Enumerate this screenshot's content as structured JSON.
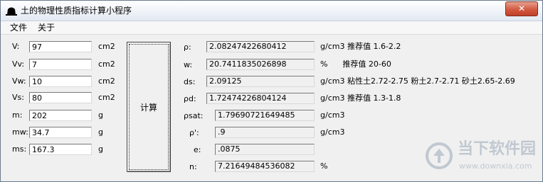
{
  "window": {
    "title": "土的物理性质指标计算小程序",
    "close_label": "✕"
  },
  "menu": {
    "items": [
      "文件",
      "关于"
    ]
  },
  "inputs": [
    {
      "label": "V:",
      "value": "97",
      "unit": "cm2"
    },
    {
      "label": "Vv:",
      "value": "7",
      "unit": "cm2"
    },
    {
      "label": "Vw:",
      "value": "10",
      "unit": "cm2"
    },
    {
      "label": "Vs:",
      "value": "80",
      "unit": "cm2"
    },
    {
      "label": "m:",
      "value": "202",
      "unit": "g"
    },
    {
      "label": "mw:",
      "value": "34.7",
      "unit": "g"
    },
    {
      "label": "ms:",
      "value": "167.3",
      "unit": "g"
    }
  ],
  "calc_button": {
    "label": "计算"
  },
  "results": [
    {
      "label": "ρ:",
      "value": "2.08247422680412",
      "unit": "g/cm3 推荐值 1.6-2.2"
    },
    {
      "label": "w:",
      "value": "20.7411835026898",
      "unit": "%      推荐值 20-60"
    },
    {
      "label": "ds:",
      "value": "2.09125",
      "unit": "g/cm3 粘性土2.72-2.75 粉土2.7-2.71 砂土2.65-2.69"
    },
    {
      "label": "ρd:",
      "value": "1.72474226804124",
      "unit": "g/cm3 推荐值 1.3-1.8"
    },
    {
      "label": "ρsat:",
      "value": "1.79690721649485",
      "unit": "g/cm3"
    },
    {
      "label": "ρ':",
      "value": ".9",
      "unit": "g/cm3"
    },
    {
      "label": "e:",
      "value": ".0875",
      "unit": ""
    },
    {
      "label": "n:",
      "value": "7.21649484536082",
      "unit": "%"
    }
  ],
  "watermark": {
    "brand_cn": "当下软件园",
    "brand_url": "www.downxia.com"
  },
  "colors": {
    "close_button": "#c0402a",
    "titlebar": "#eef2f8"
  }
}
